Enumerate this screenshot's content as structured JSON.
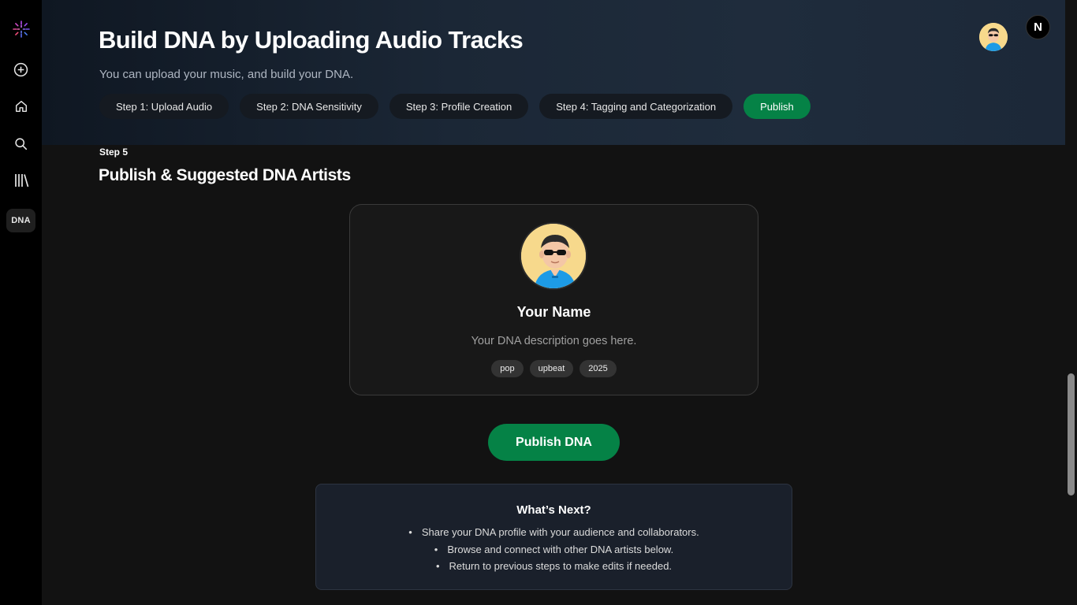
{
  "sidebar": {
    "items": [
      {
        "name": "logo",
        "icon": "dna-logo-icon"
      },
      {
        "name": "create",
        "icon": "plus-circle-icon"
      },
      {
        "name": "home",
        "icon": "home-icon"
      },
      {
        "name": "search",
        "icon": "search-icon"
      },
      {
        "name": "library",
        "icon": "library-icon"
      },
      {
        "name": "dna",
        "label": "DNA"
      }
    ]
  },
  "header": {
    "title": "Build DNA by Uploading Audio Tracks",
    "subtitle": "You can upload your music, and build your DNA.",
    "steps": [
      {
        "label": "Step 1: Upload Audio"
      },
      {
        "label": "Step 2: DNA Sensitivity"
      },
      {
        "label": "Step 3: Profile Creation"
      },
      {
        "label": "Step 4: Tagging and Categorization"
      },
      {
        "label": "Publish",
        "active": true
      }
    ],
    "user_badge": "N"
  },
  "section": {
    "step_label": "Step 5",
    "title": "Publish & Suggested DNA Artists"
  },
  "profile": {
    "name": "Your Name",
    "description": "Your DNA description goes here.",
    "tags": [
      "pop",
      "upbeat",
      "2025"
    ]
  },
  "publish_button": "Publish DNA",
  "whats_next": {
    "title": "What’s Next?",
    "items": [
      "Share your DNA profile with your audience and collaborators.",
      "Browse and connect with other DNA artists below.",
      "Return to previous steps to make edits if needed."
    ]
  },
  "colors": {
    "accent": "#058246",
    "background": "#121212",
    "sidebar": "#000000",
    "card": "#181818"
  }
}
